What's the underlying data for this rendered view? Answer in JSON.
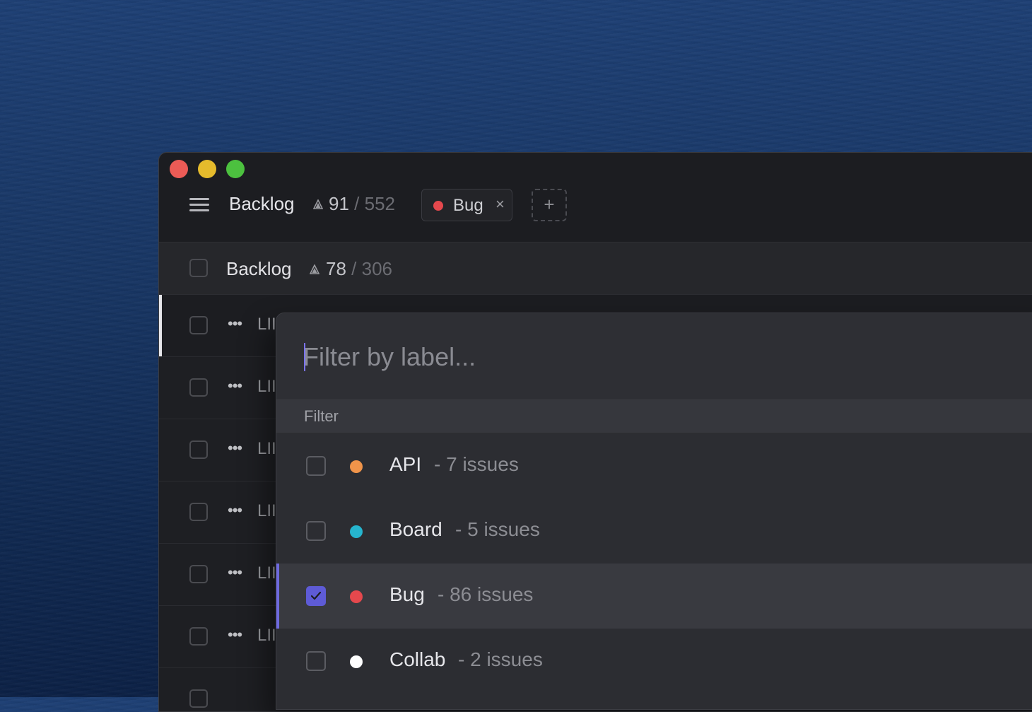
{
  "header": {
    "title": "Backlog",
    "count_current": "91",
    "count_separator": "/",
    "count_total": "552",
    "filter_chip": {
      "label": "Bug",
      "remove": "×",
      "color": "#e5484d"
    },
    "add_filter": "+"
  },
  "group": {
    "title": "Backlog",
    "count_current": "78",
    "count_separator": "/",
    "count_total": "306"
  },
  "issues": [
    {
      "more": "•••",
      "id": "LII"
    },
    {
      "more": "•••",
      "id": "LII"
    },
    {
      "more": "•••",
      "id": "LII"
    },
    {
      "more": "•••",
      "id": "LII"
    },
    {
      "more": "•••",
      "id": "LII"
    },
    {
      "more": "•••",
      "id": "LII"
    }
  ],
  "popover": {
    "search_placeholder": "Filter by label...",
    "section": "Filter",
    "options": [
      {
        "name": "API",
        "count": "- 7 issues",
        "color": "#f0944a",
        "checked": false
      },
      {
        "name": "Board",
        "count": "- 5 issues",
        "color": "#26b5ce",
        "checked": false
      },
      {
        "name": "Bug",
        "count": "- 86 issues",
        "color": "#e5484d",
        "checked": true
      },
      {
        "name": "Collab",
        "count": "- 2 issues",
        "color": "#ffffff",
        "checked": false
      }
    ]
  }
}
